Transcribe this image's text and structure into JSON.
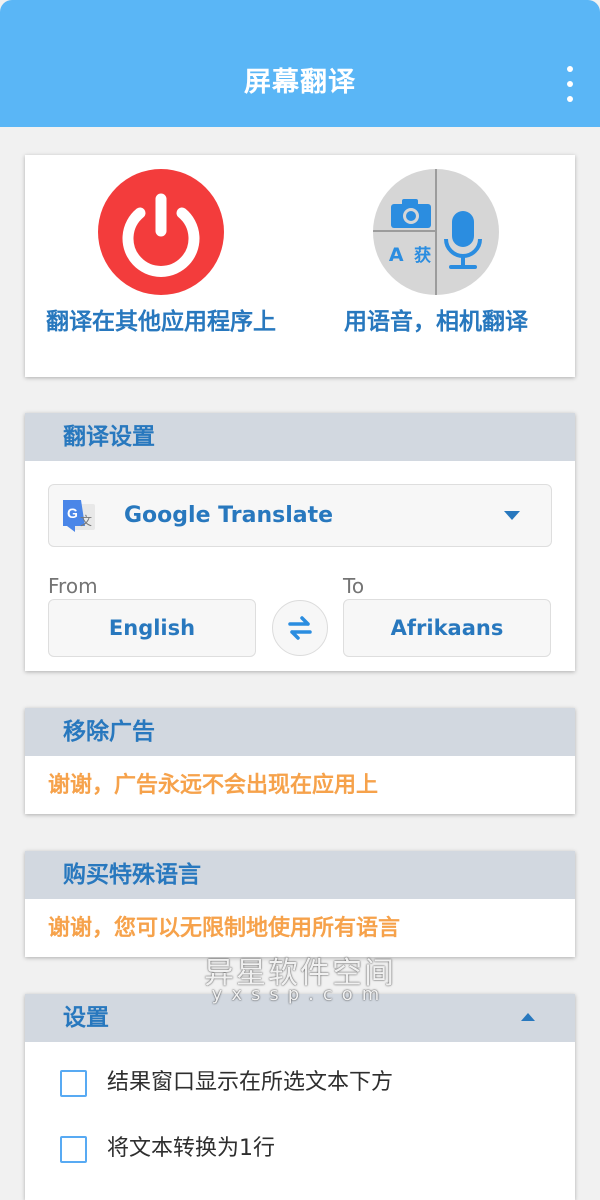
{
  "app": {
    "title": "屏幕翻译",
    "more_icon": "more-vert-icon",
    "accent_color": "#5ab6f6"
  },
  "actions": [
    {
      "label": "翻译在其他应用程序上",
      "icon": "power-icon",
      "color": "#f33c3c"
    },
    {
      "label": "用语音，相机翻译",
      "icons": [
        "camera-icon",
        "text-translate-icon",
        "microphone-icon"
      ],
      "quad_text": [
        "A",
        "获"
      ]
    }
  ],
  "translate_settings": {
    "header": "翻译设置",
    "engine": {
      "name": "Google Translate",
      "icon": "google-translate-icon",
      "g": "G",
      "wen": "文"
    },
    "from_label": "From",
    "to_label": "To",
    "from_lang": "English",
    "to_lang": "Afrikaans",
    "swap_icon": "swap-icon"
  },
  "remove_ads": {
    "header": "移除广告",
    "message": "谢谢，广告永远不会出现在应用上"
  },
  "buy_languages": {
    "header": "购买特殊语言",
    "message": "谢谢，您可以无限制地使用所有语言"
  },
  "settings": {
    "header": "设置",
    "options": [
      {
        "label": "结果窗口显示在所选文本下方",
        "checked": false
      },
      {
        "label": "将文本转换为1行",
        "checked": false
      }
    ]
  },
  "watermark": {
    "line1": "异星软件空间",
    "line2": "yxssp.com"
  }
}
